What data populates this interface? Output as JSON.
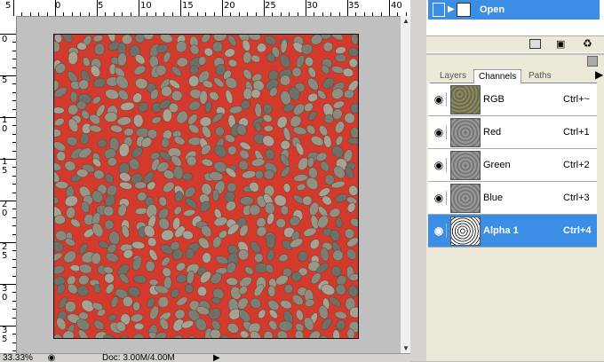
{
  "ruler": {
    "top_labels": [
      "5",
      "0",
      "5",
      "10",
      "15",
      "20",
      "25",
      "30",
      "35",
      "40"
    ],
    "left_labels": [
      "0",
      "5",
      "1\n0",
      "1\n5",
      "2\n0",
      "2\n5",
      "3\n0",
      "3\n5"
    ]
  },
  "status": {
    "zoom": "33.33%",
    "doc_info": "Doc: 3.00M/4.00M"
  },
  "history": {
    "item_label": "Open"
  },
  "channels": {
    "tabs": [
      {
        "label": "Layers",
        "active": false
      },
      {
        "label": "Channels",
        "active": true
      },
      {
        "label": "Paths",
        "active": false
      }
    ],
    "rows": [
      {
        "name": "RGB",
        "shortcut": "Ctrl+~",
        "selected": false,
        "thumb": "rgb"
      },
      {
        "name": "Red",
        "shortcut": "Ctrl+1",
        "selected": false,
        "thumb": "gray"
      },
      {
        "name": "Green",
        "shortcut": "Ctrl+2",
        "selected": false,
        "thumb": "gray"
      },
      {
        "name": "Blue",
        "shortcut": "Ctrl+3",
        "selected": false,
        "thumb": "gray"
      },
      {
        "name": "Alpha 1",
        "shortcut": "Ctrl+4",
        "selected": true,
        "thumb": "mask"
      }
    ]
  },
  "icons": {
    "history_state": "history-state-icon",
    "visibility": "eye-icon",
    "new_document": "new-document-icon",
    "snapshot": "camera-icon",
    "delete": "trash-icon"
  },
  "colors": {
    "selection_blue": "#3b8ee4",
    "quickmask_red": "#d33a2c",
    "panel_bg": "#ece9d8"
  }
}
